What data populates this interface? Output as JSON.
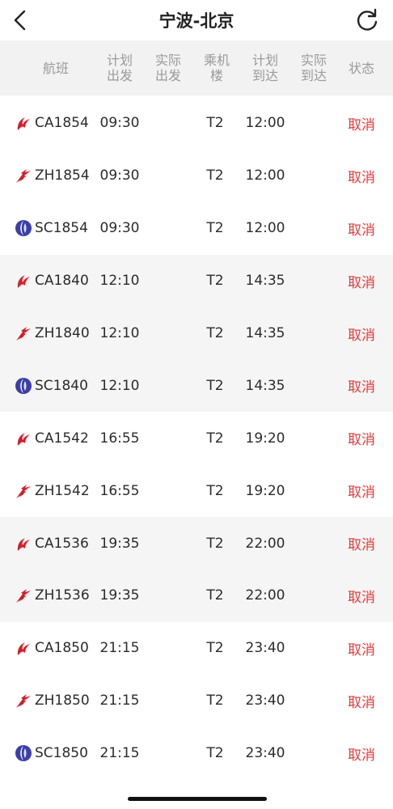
{
  "nav": {
    "title": "宁波-北京"
  },
  "columns": [
    {
      "key": "flight",
      "label": "航班"
    },
    {
      "key": "plan_dep",
      "label": "计划\n出发"
    },
    {
      "key": "act_dep",
      "label": "实际\n出发"
    },
    {
      "key": "terminal",
      "label": "乘机\n楼"
    },
    {
      "key": "plan_arr",
      "label": "计划\n到达"
    },
    {
      "key": "act_arr",
      "label": "实际\n到达"
    },
    {
      "key": "status",
      "label": "状态"
    }
  ],
  "colors": {
    "status_red": "#e23b3b",
    "air_china_red": "#d71e2a",
    "shandong_blue": "#3b3fa8",
    "shade": "#f5f5f5"
  },
  "flights": [
    {
      "airline": "air-china",
      "flight": "CA1854",
      "plan_dep": "09:30",
      "act_dep": "",
      "terminal": "T2",
      "plan_arr": "12:00",
      "act_arr": "",
      "status": "取消",
      "shade": false
    },
    {
      "airline": "shenzhen",
      "flight": "ZH1854",
      "plan_dep": "09:30",
      "act_dep": "",
      "terminal": "T2",
      "plan_arr": "12:00",
      "act_arr": "",
      "status": "取消",
      "shade": false
    },
    {
      "airline": "shandong",
      "flight": "SC1854",
      "plan_dep": "09:30",
      "act_dep": "",
      "terminal": "T2",
      "plan_arr": "12:00",
      "act_arr": "",
      "status": "取消",
      "shade": false
    },
    {
      "airline": "air-china",
      "flight": "CA1840",
      "plan_dep": "12:10",
      "act_dep": "",
      "terminal": "T2",
      "plan_arr": "14:35",
      "act_arr": "",
      "status": "取消",
      "shade": true
    },
    {
      "airline": "shenzhen",
      "flight": "ZH1840",
      "plan_dep": "12:10",
      "act_dep": "",
      "terminal": "T2",
      "plan_arr": "14:35",
      "act_arr": "",
      "status": "取消",
      "shade": true
    },
    {
      "airline": "shandong",
      "flight": "SC1840",
      "plan_dep": "12:10",
      "act_dep": "",
      "terminal": "T2",
      "plan_arr": "14:35",
      "act_arr": "",
      "status": "取消",
      "shade": true
    },
    {
      "airline": "air-china",
      "flight": "CA1542",
      "plan_dep": "16:55",
      "act_dep": "",
      "terminal": "T2",
      "plan_arr": "19:20",
      "act_arr": "",
      "status": "取消",
      "shade": false
    },
    {
      "airline": "shenzhen",
      "flight": "ZH1542",
      "plan_dep": "16:55",
      "act_dep": "",
      "terminal": "T2",
      "plan_arr": "19:20",
      "act_arr": "",
      "status": "取消",
      "shade": false
    },
    {
      "airline": "air-china",
      "flight": "CA1536",
      "plan_dep": "19:35",
      "act_dep": "",
      "terminal": "T2",
      "plan_arr": "22:00",
      "act_arr": "",
      "status": "取消",
      "shade": true
    },
    {
      "airline": "shenzhen",
      "flight": "ZH1536",
      "plan_dep": "19:35",
      "act_dep": "",
      "terminal": "T2",
      "plan_arr": "22:00",
      "act_arr": "",
      "status": "取消",
      "shade": true
    },
    {
      "airline": "air-china",
      "flight": "CA1850",
      "plan_dep": "21:15",
      "act_dep": "",
      "terminal": "T2",
      "plan_arr": "23:40",
      "act_arr": "",
      "status": "取消",
      "shade": false
    },
    {
      "airline": "shenzhen",
      "flight": "ZH1850",
      "plan_dep": "21:15",
      "act_dep": "",
      "terminal": "T2",
      "plan_arr": "23:40",
      "act_arr": "",
      "status": "取消",
      "shade": false
    },
    {
      "airline": "shandong",
      "flight": "SC1850",
      "plan_dep": "21:15",
      "act_dep": "",
      "terminal": "T2",
      "plan_arr": "23:40",
      "act_arr": "",
      "status": "取消",
      "shade": false
    }
  ]
}
